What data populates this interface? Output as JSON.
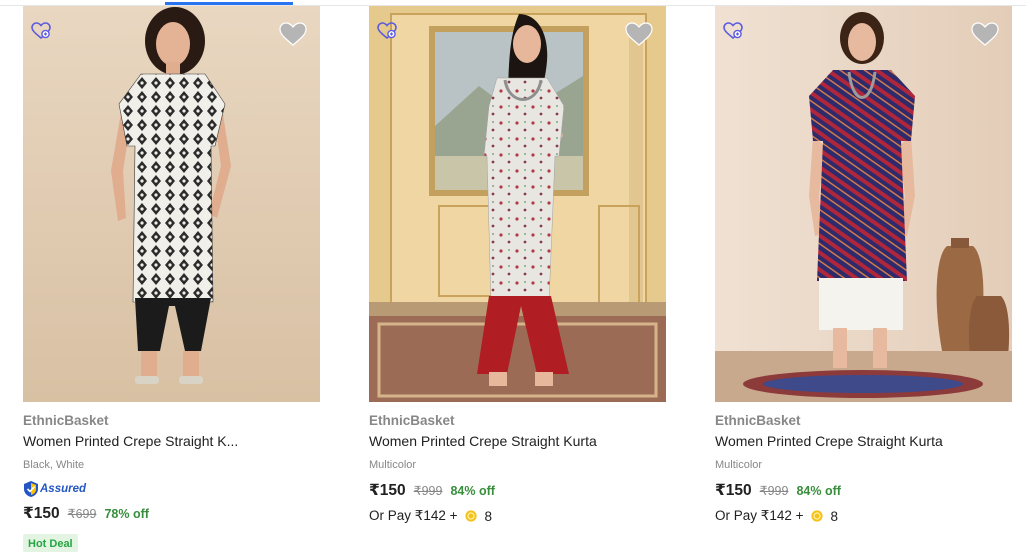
{
  "products": [
    {
      "brand": "EthnicBasket",
      "title": "Women Printed Crepe Straight K...",
      "variant": "Black, White",
      "assured_label": "Assured",
      "price": "₹150",
      "mrp": "₹699",
      "discount": "78% off",
      "badge": "Hot Deal",
      "image": "woman in black-and-white printed kurta with black pants",
      "compare_icon": "compare-heart-icon",
      "wishlist_icon": "heart-icon"
    },
    {
      "brand": "EthnicBasket",
      "title": "Women Printed Crepe Straight Kurta",
      "variant": "Multicolor",
      "price": "₹150",
      "mrp": "₹999",
      "discount": "84% off",
      "pay_text": "Or Pay ₹142 +",
      "coins": "8",
      "image": "woman in white floral kurta with red palazzo",
      "compare_icon": "compare-heart-icon",
      "wishlist_icon": "heart-icon"
    },
    {
      "brand": "EthnicBasket",
      "title": "Women Printed Crepe Straight Kurta",
      "variant": "Multicolor",
      "price": "₹150",
      "mrp": "₹999",
      "discount": "84% off",
      "pay_text": "Or Pay ₹142 +",
      "coins": "8",
      "image": "woman in purple striped kurta with white pants",
      "compare_icon": "compare-heart-icon",
      "wishlist_icon": "heart-icon"
    }
  ],
  "colors": {
    "discount_green": "#388e3c",
    "assured_blue": "#2455c3",
    "hot_deal_bg": "#e3f4e3",
    "hot_deal_text": "#26a541",
    "muted_text": "#878787",
    "wishlist_gray": "#b5b5b5",
    "compare_purple": "#5b5be0",
    "coin_gold": "#f4c21a"
  }
}
